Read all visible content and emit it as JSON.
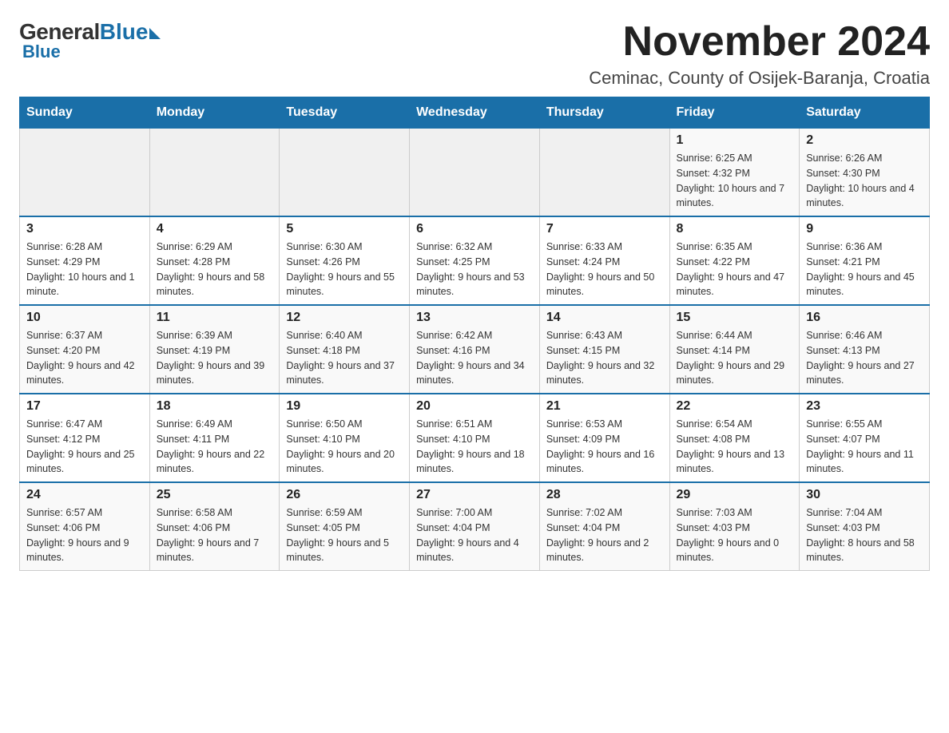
{
  "logo": {
    "general": "General",
    "blue": "Blue",
    "sub": "Blue"
  },
  "title": {
    "month": "November 2024",
    "location": "Ceminac, County of Osijek-Baranja, Croatia"
  },
  "headers": [
    "Sunday",
    "Monday",
    "Tuesday",
    "Wednesday",
    "Thursday",
    "Friday",
    "Saturday"
  ],
  "weeks": [
    [
      {
        "day": "",
        "sunrise": "",
        "sunset": "",
        "daylight": ""
      },
      {
        "day": "",
        "sunrise": "",
        "sunset": "",
        "daylight": ""
      },
      {
        "day": "",
        "sunrise": "",
        "sunset": "",
        "daylight": ""
      },
      {
        "day": "",
        "sunrise": "",
        "sunset": "",
        "daylight": ""
      },
      {
        "day": "",
        "sunrise": "",
        "sunset": "",
        "daylight": ""
      },
      {
        "day": "1",
        "sunrise": "Sunrise: 6:25 AM",
        "sunset": "Sunset: 4:32 PM",
        "daylight": "Daylight: 10 hours and 7 minutes."
      },
      {
        "day": "2",
        "sunrise": "Sunrise: 6:26 AM",
        "sunset": "Sunset: 4:30 PM",
        "daylight": "Daylight: 10 hours and 4 minutes."
      }
    ],
    [
      {
        "day": "3",
        "sunrise": "Sunrise: 6:28 AM",
        "sunset": "Sunset: 4:29 PM",
        "daylight": "Daylight: 10 hours and 1 minute."
      },
      {
        "day": "4",
        "sunrise": "Sunrise: 6:29 AM",
        "sunset": "Sunset: 4:28 PM",
        "daylight": "Daylight: 9 hours and 58 minutes."
      },
      {
        "day": "5",
        "sunrise": "Sunrise: 6:30 AM",
        "sunset": "Sunset: 4:26 PM",
        "daylight": "Daylight: 9 hours and 55 minutes."
      },
      {
        "day": "6",
        "sunrise": "Sunrise: 6:32 AM",
        "sunset": "Sunset: 4:25 PM",
        "daylight": "Daylight: 9 hours and 53 minutes."
      },
      {
        "day": "7",
        "sunrise": "Sunrise: 6:33 AM",
        "sunset": "Sunset: 4:24 PM",
        "daylight": "Daylight: 9 hours and 50 minutes."
      },
      {
        "day": "8",
        "sunrise": "Sunrise: 6:35 AM",
        "sunset": "Sunset: 4:22 PM",
        "daylight": "Daylight: 9 hours and 47 minutes."
      },
      {
        "day": "9",
        "sunrise": "Sunrise: 6:36 AM",
        "sunset": "Sunset: 4:21 PM",
        "daylight": "Daylight: 9 hours and 45 minutes."
      }
    ],
    [
      {
        "day": "10",
        "sunrise": "Sunrise: 6:37 AM",
        "sunset": "Sunset: 4:20 PM",
        "daylight": "Daylight: 9 hours and 42 minutes."
      },
      {
        "day": "11",
        "sunrise": "Sunrise: 6:39 AM",
        "sunset": "Sunset: 4:19 PM",
        "daylight": "Daylight: 9 hours and 39 minutes."
      },
      {
        "day": "12",
        "sunrise": "Sunrise: 6:40 AM",
        "sunset": "Sunset: 4:18 PM",
        "daylight": "Daylight: 9 hours and 37 minutes."
      },
      {
        "day": "13",
        "sunrise": "Sunrise: 6:42 AM",
        "sunset": "Sunset: 4:16 PM",
        "daylight": "Daylight: 9 hours and 34 minutes."
      },
      {
        "day": "14",
        "sunrise": "Sunrise: 6:43 AM",
        "sunset": "Sunset: 4:15 PM",
        "daylight": "Daylight: 9 hours and 32 minutes."
      },
      {
        "day": "15",
        "sunrise": "Sunrise: 6:44 AM",
        "sunset": "Sunset: 4:14 PM",
        "daylight": "Daylight: 9 hours and 29 minutes."
      },
      {
        "day": "16",
        "sunrise": "Sunrise: 6:46 AM",
        "sunset": "Sunset: 4:13 PM",
        "daylight": "Daylight: 9 hours and 27 minutes."
      }
    ],
    [
      {
        "day": "17",
        "sunrise": "Sunrise: 6:47 AM",
        "sunset": "Sunset: 4:12 PM",
        "daylight": "Daylight: 9 hours and 25 minutes."
      },
      {
        "day": "18",
        "sunrise": "Sunrise: 6:49 AM",
        "sunset": "Sunset: 4:11 PM",
        "daylight": "Daylight: 9 hours and 22 minutes."
      },
      {
        "day": "19",
        "sunrise": "Sunrise: 6:50 AM",
        "sunset": "Sunset: 4:10 PM",
        "daylight": "Daylight: 9 hours and 20 minutes."
      },
      {
        "day": "20",
        "sunrise": "Sunrise: 6:51 AM",
        "sunset": "Sunset: 4:10 PM",
        "daylight": "Daylight: 9 hours and 18 minutes."
      },
      {
        "day": "21",
        "sunrise": "Sunrise: 6:53 AM",
        "sunset": "Sunset: 4:09 PM",
        "daylight": "Daylight: 9 hours and 16 minutes."
      },
      {
        "day": "22",
        "sunrise": "Sunrise: 6:54 AM",
        "sunset": "Sunset: 4:08 PM",
        "daylight": "Daylight: 9 hours and 13 minutes."
      },
      {
        "day": "23",
        "sunrise": "Sunrise: 6:55 AM",
        "sunset": "Sunset: 4:07 PM",
        "daylight": "Daylight: 9 hours and 11 minutes."
      }
    ],
    [
      {
        "day": "24",
        "sunrise": "Sunrise: 6:57 AM",
        "sunset": "Sunset: 4:06 PM",
        "daylight": "Daylight: 9 hours and 9 minutes."
      },
      {
        "day": "25",
        "sunrise": "Sunrise: 6:58 AM",
        "sunset": "Sunset: 4:06 PM",
        "daylight": "Daylight: 9 hours and 7 minutes."
      },
      {
        "day": "26",
        "sunrise": "Sunrise: 6:59 AM",
        "sunset": "Sunset: 4:05 PM",
        "daylight": "Daylight: 9 hours and 5 minutes."
      },
      {
        "day": "27",
        "sunrise": "Sunrise: 7:00 AM",
        "sunset": "Sunset: 4:04 PM",
        "daylight": "Daylight: 9 hours and 4 minutes."
      },
      {
        "day": "28",
        "sunrise": "Sunrise: 7:02 AM",
        "sunset": "Sunset: 4:04 PM",
        "daylight": "Daylight: 9 hours and 2 minutes."
      },
      {
        "day": "29",
        "sunrise": "Sunrise: 7:03 AM",
        "sunset": "Sunset: 4:03 PM",
        "daylight": "Daylight: 9 hours and 0 minutes."
      },
      {
        "day": "30",
        "sunrise": "Sunrise: 7:04 AM",
        "sunset": "Sunset: 4:03 PM",
        "daylight": "Daylight: 8 hours and 58 minutes."
      }
    ]
  ]
}
